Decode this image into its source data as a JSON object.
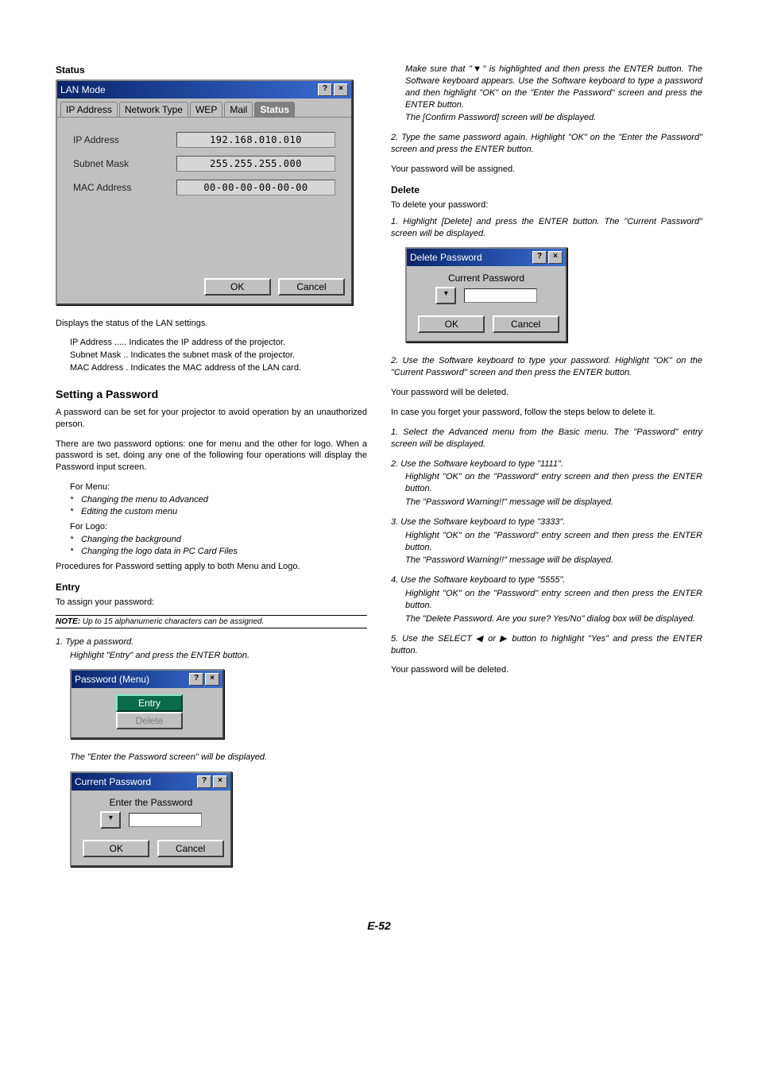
{
  "pageNumber": "E-52",
  "left": {
    "statusHeading": "Status",
    "lanDialog": {
      "title": "LAN Mode",
      "help": "?",
      "close": "×",
      "tabs": [
        "IP Address",
        "Network Type",
        "WEP",
        "Mail",
        "Status"
      ],
      "fields": {
        "ipLabel": "IP Address",
        "ipValue": "192.168.010.010",
        "snLabel": "Subnet Mask",
        "snValue": "255.255.255.000",
        "macLabel": "MAC Address",
        "macValue": "00-00-00-00-00-00"
      },
      "ok": "OK",
      "cancel": "Cancel"
    },
    "statusDesc": "Displays the status of the LAN settings.",
    "defs": {
      "ip": "IP Address ..... Indicates the IP address of the projector.",
      "sn": "Subnet Mask .. Indicates the subnet mask of the projector.",
      "mac": "MAC Address . Indicates the MAC address of the LAN card."
    },
    "pwdHeading": "Setting a Password",
    "pwdP1": "A password can be set for your projector to avoid operation by an unauthorized person.",
    "pwdP2": "There are two password options: one for menu and the other for logo. When a password is set, doing any one of the following four operations will display the Password input screen.",
    "forMenu": "For Menu:",
    "menuItems": [
      "Changing the menu to Advanced",
      "Editing the custom menu"
    ],
    "forLogo": "For Logo:",
    "logoItems": [
      "Changing the background",
      "Changing the logo data in PC Card Files"
    ],
    "pwdProc": "Procedures for Password setting apply to both Menu and Logo.",
    "entryHeading": "Entry",
    "entryDesc": "To assign your password:",
    "noteLabel": "NOTE:",
    "noteText": " Up to 15 alphanumeric characters can be assigned.",
    "entryStep1a": "1. Type a password.",
    "entryStep1b": "Highlight \"Entry\" and press the ENTER button.",
    "pwdMenuDialog": {
      "title": "Password (Menu)",
      "entry": "Entry",
      "delete": "Delete"
    },
    "enterPwShown": "The \"Enter the Password screen\" will be displayed.",
    "curPwdDialog": {
      "title": "Current Password",
      "label": "Enter the Password",
      "ok": "OK",
      "cancel": "Cancel"
    }
  },
  "right": {
    "topItalic1": "Make sure that \"▼\" is highlighted and then press the ENTER button. The Software keyboard appears. Use the Software keyboard to type a password and then highlight \"OK\" on the \"Enter the Password\" screen and press the ENTER button.",
    "topItalic2": "The [Confirm Password] screen will be displayed.",
    "step2": "2. Type the same password again. Highlight \"OK\" on the \"Enter the Password\" screen and press the ENTER button.",
    "assigned": "Your password will be assigned.",
    "deleteHeading": "Delete",
    "deleteDesc": "To delete your password:",
    "delStep1": "1. Highlight [Delete] and press the ENTER button. The \"Current Password\" screen will be displayed.",
    "delDialog": {
      "title": "Delete Password",
      "label": "Current Password",
      "ok": "OK",
      "cancel": "Cancel"
    },
    "delStep2": "2. Use the Software keyboard to type your password. Highlight \"OK\" on the \"Current Password\" screen and then press the ENTER button.",
    "deleted1": "Your password will be deleted.",
    "forgot": "In case you forget your password, follow the steps below to delete it.",
    "fg1": "1. Select the Advanced menu from the Basic menu. The \"Password\" entry screen will be displayed.",
    "fg2a": "2. Use the Software keyboard to type \"1111\".",
    "fg2b": "Highlight \"OK\" on the \"Password\" entry screen and then press the ENTER button.",
    "fg2c": "The \"Password Warning!!\" message will be displayed.",
    "fg3a": "3. Use the Software keyboard to type \"3333\".",
    "fg3b": "Highlight \"OK\" on the \"Password\" entry screen and then press the ENTER button.",
    "fg3c": "The \"Password Warning!!\" message will be displayed.",
    "fg4a": "4. Use the Software keyboard to type \"5555\".",
    "fg4b": "Highlight \"OK\" on the \"Password\" entry screen and then press the ENTER button.",
    "fg4c": "The \"Delete Password. Are you sure? Yes/No\" dialog box will be displayed.",
    "fg5": "5. Use the SELECT ◀ or ▶ button to highlight \"Yes\" and press the ENTER button.",
    "deleted2": "Your password will be deleted."
  }
}
